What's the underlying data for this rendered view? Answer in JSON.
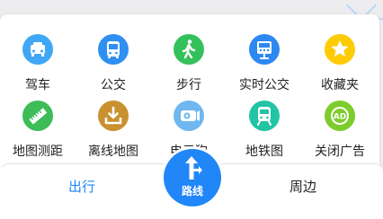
{
  "grid": {
    "items": [
      {
        "label": "驾车",
        "icon": "car-icon",
        "color": "#3fa7f5"
      },
      {
        "label": "公交",
        "icon": "bus-icon",
        "color": "#2f8ff2"
      },
      {
        "label": "步行",
        "icon": "walk-icon",
        "color": "#34c05a"
      },
      {
        "label": "实时公交",
        "icon": "realtime-bus-icon",
        "color": "#2d88f0"
      },
      {
        "label": "收藏夹",
        "icon": "star-icon",
        "color": "#ffcb05"
      },
      {
        "label": "地图测距",
        "icon": "ruler-icon",
        "color": "#3dbc58"
      },
      {
        "label": "离线地图",
        "icon": "download-icon",
        "color": "#c9912f"
      },
      {
        "label": "电子狗",
        "icon": "camera-icon",
        "color": "#6fb7ee"
      },
      {
        "label": "地铁图",
        "icon": "subway-icon",
        "color": "#23c3a6"
      },
      {
        "label": "关闭广告",
        "icon": "ad-close-icon",
        "color": "#7dcc2c"
      }
    ]
  },
  "bottom_bar": {
    "left_tab": "出行",
    "center_button": "路线",
    "right_tab": "周边",
    "active_color": "#2186f7"
  }
}
